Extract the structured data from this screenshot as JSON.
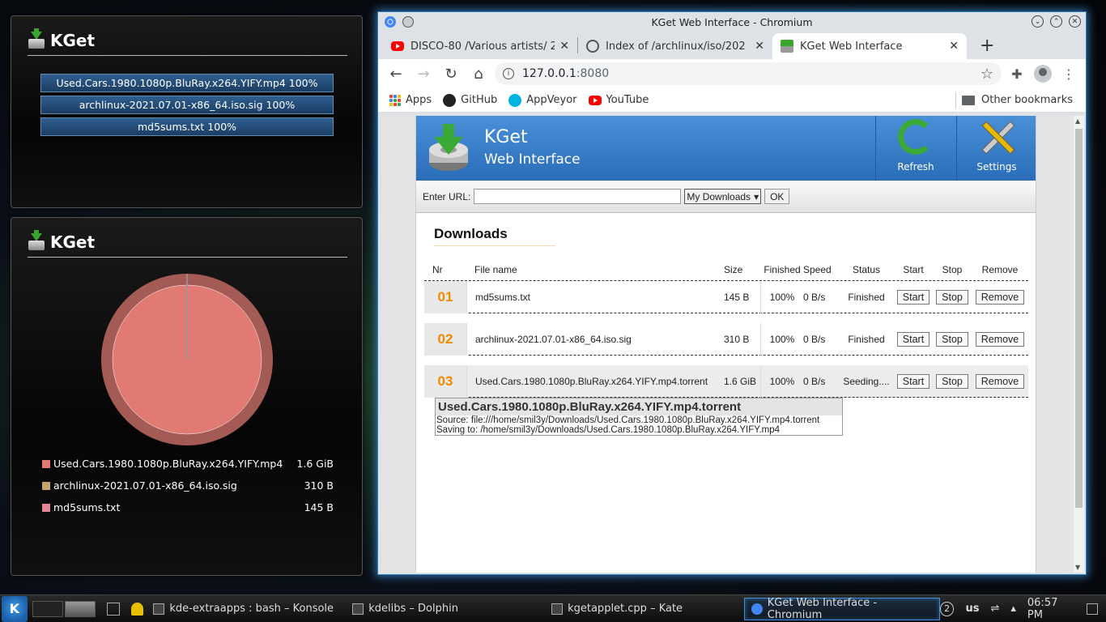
{
  "applet_bars": {
    "title": "KGet",
    "items": [
      "Used.Cars.1980.1080p.BluRay.x264.YIFY.mp4 100%",
      "archlinux-2021.07.01-x86_64.iso.sig 100%",
      "md5sums.txt 100%"
    ]
  },
  "applet_pie": {
    "title": "KGet",
    "legend": [
      {
        "name": "Used.Cars.1980.1080p.BluRay.x264.YIFY.mp4",
        "size": "1.6 GiB",
        "color": "#e07a73"
      },
      {
        "name": "archlinux-2021.07.01-x86_64.iso.sig",
        "size": "310 B",
        "color": "#c4a36a"
      },
      {
        "name": "md5sums.txt",
        "size": "145 B",
        "color": "#e3869a"
      }
    ]
  },
  "chart_data": {
    "type": "pie",
    "categories": [
      "Used.Cars.1980.1080p.BluRay.x264.YIFY.mp4",
      "archlinux-2021.07.01-x86_64.iso.sig",
      "md5sums.txt"
    ],
    "values": [
      1717986918,
      310,
      145
    ],
    "colors": [
      "#e07a73",
      "#c4a36a",
      "#e3869a"
    ]
  },
  "window": {
    "title": "KGet Web Interface - Chromium"
  },
  "tabs": [
    {
      "label": "DISCO-80 /Various artists/ 2",
      "icon": "youtube-icon"
    },
    {
      "label": "Index of /archlinux/iso/202",
      "icon": "globe-icon"
    },
    {
      "label": "KGet Web Interface",
      "icon": "kget-icon"
    }
  ],
  "omnibox": {
    "host": "127.0.0.1",
    "port": ":8080"
  },
  "bookmarks": {
    "items": [
      "Apps",
      "GitHub",
      "AppVeyor",
      "YouTube"
    ],
    "other": "Other bookmarks"
  },
  "page": {
    "header_title": "KGet",
    "header_subtitle": "Web Interface",
    "refresh_label": "Refresh",
    "settings_label": "Settings",
    "enter_url_label": "Enter URL:",
    "destination": "My Downloads",
    "ok_label": "OK",
    "downloads_heading": "Downloads",
    "columns": [
      "Nr",
      "File name",
      "Size",
      "Finished",
      "Speed",
      "Status",
      "Start",
      "Stop",
      "Remove"
    ],
    "rows": [
      {
        "nr": "01",
        "name": "md5sums.txt",
        "size": "145 B",
        "finished": "100%",
        "speed": "0 B/s",
        "status": "Finished"
      },
      {
        "nr": "02",
        "name": "archlinux-2021.07.01-x86_64.iso.sig",
        "size": "310 B",
        "finished": "100%",
        "speed": "0 B/s",
        "status": "Finished"
      },
      {
        "nr": "03",
        "name": "Used.Cars.1980.1080p.BluRay.x264.YIFY.mp4.torrent",
        "size": "1.6 GiB",
        "finished": "100%",
        "speed": "0 B/s",
        "status": "Seeding...."
      }
    ],
    "btn_start": "Start",
    "btn_stop": "Stop",
    "btn_remove": "Remove",
    "tooltip": {
      "title": "Used.Cars.1980.1080p.BluRay.x264.YIFY.mp4.torrent",
      "source": "Source: file:///home/smil3y/Downloads/Used.Cars.1980.1080p.BluRay.x264.YIFY.mp4.torrent",
      "saving": "Saving to: /home/smil3y/Downloads/Used.Cars.1980.1080p.BluRay.x264.YIFY.mp4"
    }
  },
  "taskbar": {
    "tasks": [
      {
        "label": "kde-extraapps : bash – Konsole"
      },
      {
        "label": "kdelibs – Dolphin"
      },
      {
        "label": "kgetapplet.cpp – Kate"
      },
      {
        "label": "KGet Web Interface - Chromium"
      }
    ],
    "desktop_number": "2",
    "keyboard_layout": "us",
    "clock": "06:57 PM"
  }
}
